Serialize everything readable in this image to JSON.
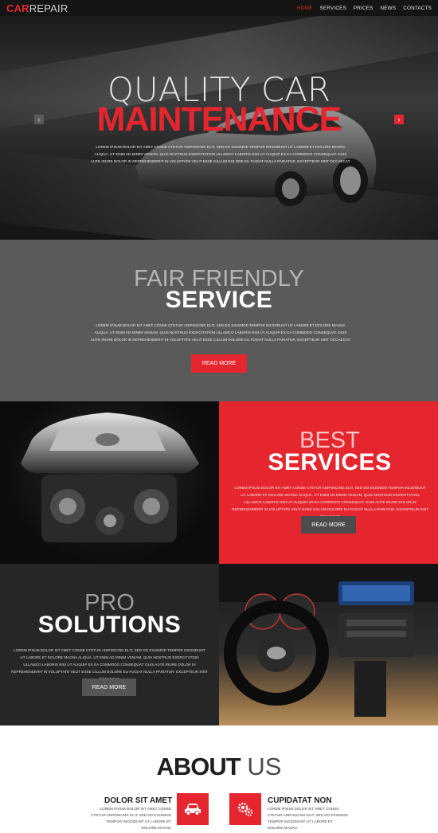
{
  "nav": {
    "logo_part1": "CAR",
    "logo_part2": "REPAIR",
    "items": [
      "HOME",
      "SERVICES",
      "PRICES",
      "NEWS",
      "CONTACTS"
    ],
    "active": "HOME"
  },
  "hero": {
    "title_line1": "QUALITY CAR",
    "title_line2": "MAINTENANCE",
    "text": "LOREM IPSUM DOLOR SIT AMET CONSE CTETUR ADIPISICING ELIT, SED DO EIUSMOD TEMPOR INCIDIDUNT UT LABORE ET DOLORE MAGNA ALIQUA. UT ENIM AD MINIM VENIAM, QUIS NOSTRUD EXERCITATION ULLAMCO LABORIS NISI UT ALIQUIP EX EA COMMODO CONSEQUAT. DUIS AUTE IRURE DOLOR IN REPREHENDERIT IN VOLUPTATE VELIT ESSE CILLUM DOLORE EU FUGIAT NULLA PARIATUR. EXCEPTEUR SINT OCCAECAT.",
    "prev_arrow": "‹",
    "next_arrow": "›"
  },
  "fair": {
    "title_line1": "FAIR FRIENDLY",
    "title_line2": "SERVICE",
    "text": "LOREM IPSUM DOLOR SIT AMET CONSE CTETUR ADIPISICING ELIT, SED DO EIUSMOD TEMPOR INCIDIDUNT UT LABORE ET DOLORE MAGNA ALIQUA. UT ENIM AD MINIM VENIAM, QUIS NOSTRUD EXERCITATION ULLAMCO LABORIS NISI UT ALIQUIP EX EA COMMODO CONSEQUAT. DUIS AUTE IRURE DOLOR IN REPREHENDERIT IN VOLUPTATE VELIT ESSE CILLUM DOLORE EU FUGIAT NULLA PARIATUR. EXCEPTEUR SINT OCCAECAT.",
    "button": "READ MORE"
  },
  "best": {
    "title_line1": "BEST",
    "title_line2": "SERVICES",
    "text": "LOREM IPSUM DOLOR SIT AMET CONSE CTETUR ADIPISICING ELIT, SED DO EIUSMOD TEMPOR INCIDIDUNT UT LABORE ET DOLORE MAGNA ALIQUA. UT ENIM AD MINIM VENIAM, QUIS NOSTRUD EXERCITATION ULLAMCO LABORIS NISI UT ALIQUIP EX EA COMMODO CONSEQUAT. DUIS AUTE IRURE DOLOR IN REPREHENDERIT IN VOLUPTATE VELIT ESSE CILLUM DOLORE EU FUGIAT NULLA PARIATUR. EXCEPTEUR SINT OCCAECAT.",
    "button": "READ MORE"
  },
  "pro": {
    "title_line1": "PRO",
    "title_line2": "SOLUTIONS",
    "text": "LOREM IPSUM DOLOR SIT AMET CONSE CTETUR ADIPISICING ELIT, SED DO EIUSMOD TEMPOR INCIDIDUNT UT LABORE ET DOLORE MAGNA ALIQUA. UT ENIM AD MINIM VENIAM, QUIS NOSTRUD EXERCITATION ULLAMCO LABORIS NISI UT ALIQUIP EX EA COMMODO CONSEQUAT. DUIS AUTE IRURE DOLOR IN REPREHENDERIT IN VOLUPTATE VELIT ESSE CILLUM DOLORE EU FUGIAT NULLA PARIATUR. EXCEPTEUR SINT OCCAECAT.",
    "button": "READ MORE"
  },
  "about": {
    "title_bold": "ABOUT",
    "title_light": "US",
    "feature1": {
      "title": "DOLOR SIT AMET",
      "text": "LOREM IPSUM DOLOR SIT AMET CONSE CTETUR ADIPISICING ELIT, SED DO EIUSMOD TEMPOR INCIDIDUNT UT LABORE ET DOLORE MAGNA",
      "icon": "car-icon"
    },
    "feature2": {
      "title": "CUPIDATAT NON",
      "text": "LOREM IPSUM DOLOR SIT AMET CONSE CTETUR ADIPISICING ELIT, SED DO EIUSMOD TEMPOR INCIDIDUNT UT LABORE ET DOLORE MAGNA",
      "icon": "gears-icon"
    }
  },
  "colors": {
    "accent": "#e5262f",
    "dark": "#262626",
    "gray": "#5a5a5a",
    "nav": "#141414"
  }
}
